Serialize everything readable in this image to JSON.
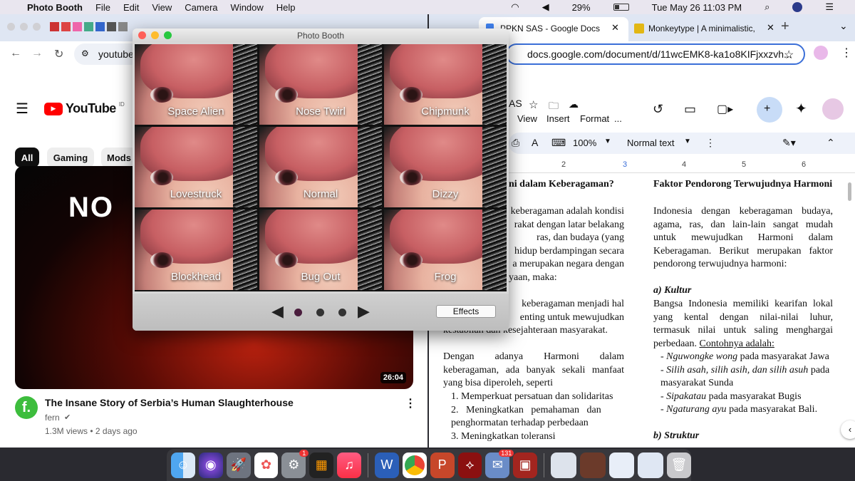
{
  "menubar": {
    "app": "Photo Booth",
    "items": [
      "File",
      "Edit",
      "View",
      "Camera",
      "Window",
      "Help"
    ],
    "battery": "29%",
    "clock": "Tue May 26  11:03 PM"
  },
  "left_browser": {
    "url": "youtube",
    "brand": "YouTube",
    "region": "ID",
    "chips": [
      "All",
      "Gaming",
      "Mods"
    ],
    "thumb_text": "NO",
    "duration": "26:04",
    "video_title": "The Insane Story of Serbia’s Human Slaughterhouse",
    "channel": "fern",
    "meta": "1.3M views • 2 days ago"
  },
  "right_browser": {
    "tab1": "PPKN SAS - Google Docs",
    "tab2": "Monkeytype | A minimalistic,",
    "url": "docs.google.com/document/d/11wcEMK8-ka1o8KIFjxxzvh...",
    "menu": [
      "View",
      "Insert",
      "Format",
      "..."
    ],
    "doc_partial": "AS",
    "zoom": "100%",
    "style": "Normal text",
    "ruler": [
      "2",
      "3",
      "4",
      "5",
      "6"
    ]
  },
  "doc": {
    "left_heading": "ni dalam Keberagaman?",
    "left_p1": [
      "keberagaman adalah kondisi",
      "rakat dengan latar belakang",
      "ras, dan budaya (yang",
      "hidup berdampingan secara",
      "a merupakan negara dengan",
      "yaan, maka:"
    ],
    "left_p2": [
      "keberagaman menjadi hal",
      "enting untuk mewujudkan",
      "kestabilan dan kesejahteraan masyarakat."
    ],
    "left_p3": [
      "Dengan adanya Harmoni dalam",
      "keberagaman, ada banyak sekali manfaat",
      "yang bisa diperoleh, seperti"
    ],
    "left_list": [
      "1. Memperkuat persatuan dan solidaritas",
      "2.   Meningkatkan   pemahaman   dan",
      "penghormatan terhadap perbedaan",
      "3. Meningkatkan toleransi"
    ],
    "right_heading": "Faktor Pendorong Terwujudnya Harmoni",
    "right_p1": [
      "Indonesia dengan keberagaman budaya,",
      "agama, ras, dan lain-lain sangat mudah",
      "untuk mewujudkan Harmoni dalam",
      "Keberagaman. Berikut merupakan faktor",
      "pendorong terwujudnya harmoni:"
    ],
    "right_sub_a": "a) Kultur",
    "right_p2": [
      "Bangsa Indonesia memiliki kearifan lokal",
      "yang kental dengan nilai-nilai luhur,",
      "termasuk nilai untuk saling menghargai"
    ],
    "right_p2_last": "perbedaan.",
    "right_contoh": "Contohnya adalah:",
    "right_list": [
      {
        "em": "Nguwongke wong",
        "rest": " pada masyarakat Jawa"
      },
      {
        "em": "Silih asah, silih asih, dan silih asuh",
        "rest": " pada"
      },
      {
        "em": "",
        "rest": "masyarakat Sunda"
      },
      {
        "em": "Sipakatau",
        "rest": " pada masyarakat Bugis"
      },
      {
        "em": "Ngaturang ayu",
        "rest": " pada masyarakat Bali."
      }
    ],
    "right_sub_b": "b) Struktur"
  },
  "photobooth": {
    "title": "Photo Booth",
    "effects": [
      "Space Alien",
      "Nose Twirl",
      "Chipmunk",
      "Lovestruck",
      "Normal",
      "Dizzy",
      "Blockhead",
      "Bug Out",
      "Frog"
    ],
    "effects_button": "Effects",
    "page_selected": 0,
    "page_count": 3
  },
  "dock": {
    "settings_badge": "1",
    "mail_badge": "131"
  }
}
